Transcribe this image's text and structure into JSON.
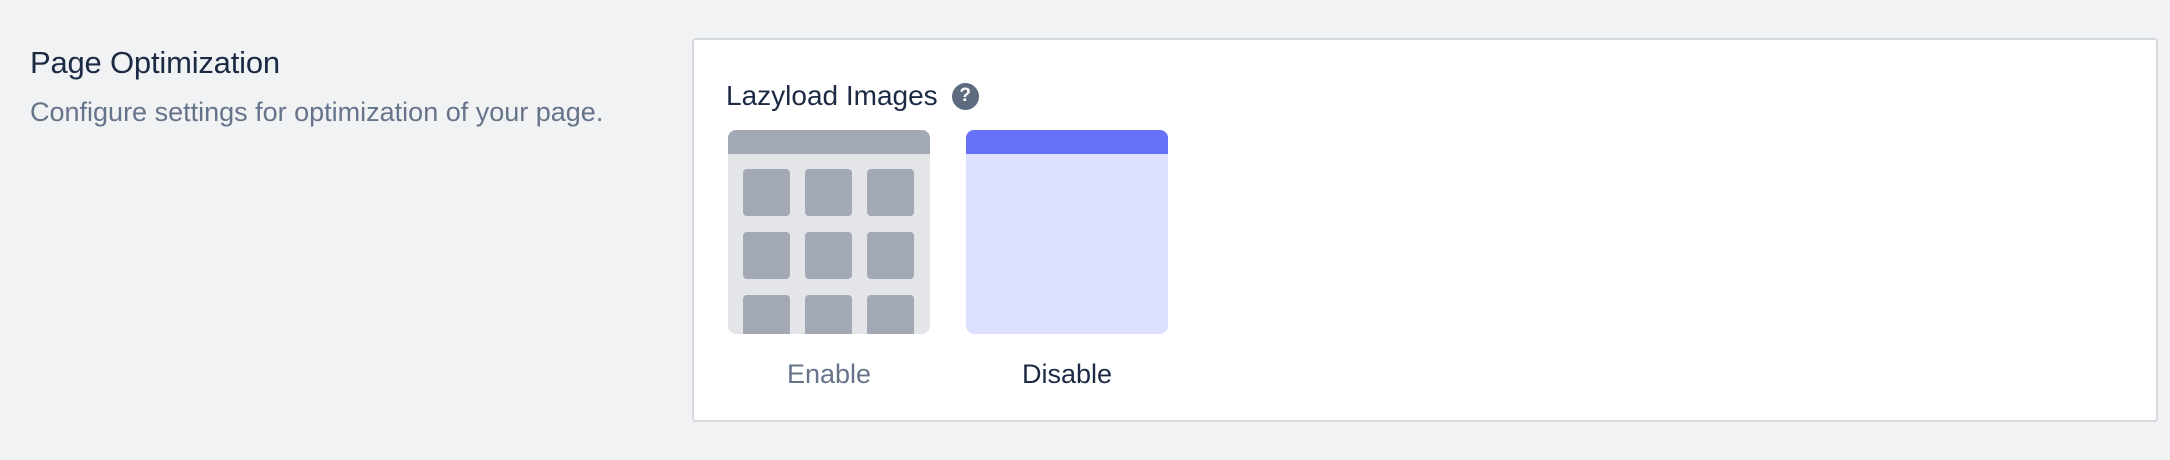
{
  "section": {
    "title": "Page Optimization",
    "description": "Configure settings for optimization of your page."
  },
  "field": {
    "label": "Lazyload Images",
    "help_icon": "?",
    "options": [
      {
        "label": "Enable",
        "selected": false,
        "icon": "image-grid-thumbnail"
      },
      {
        "label": "Disable",
        "selected": true,
        "icon": "blank-page-thumbnail"
      }
    ]
  },
  "colors": {
    "accent": "#6872f8",
    "accent_light": "#dee0ff",
    "thumb_gray": "#a2a8b4",
    "thumb_bg": "#e4e5e9",
    "text_primary": "#1c2a44",
    "text_muted": "#66748a"
  }
}
